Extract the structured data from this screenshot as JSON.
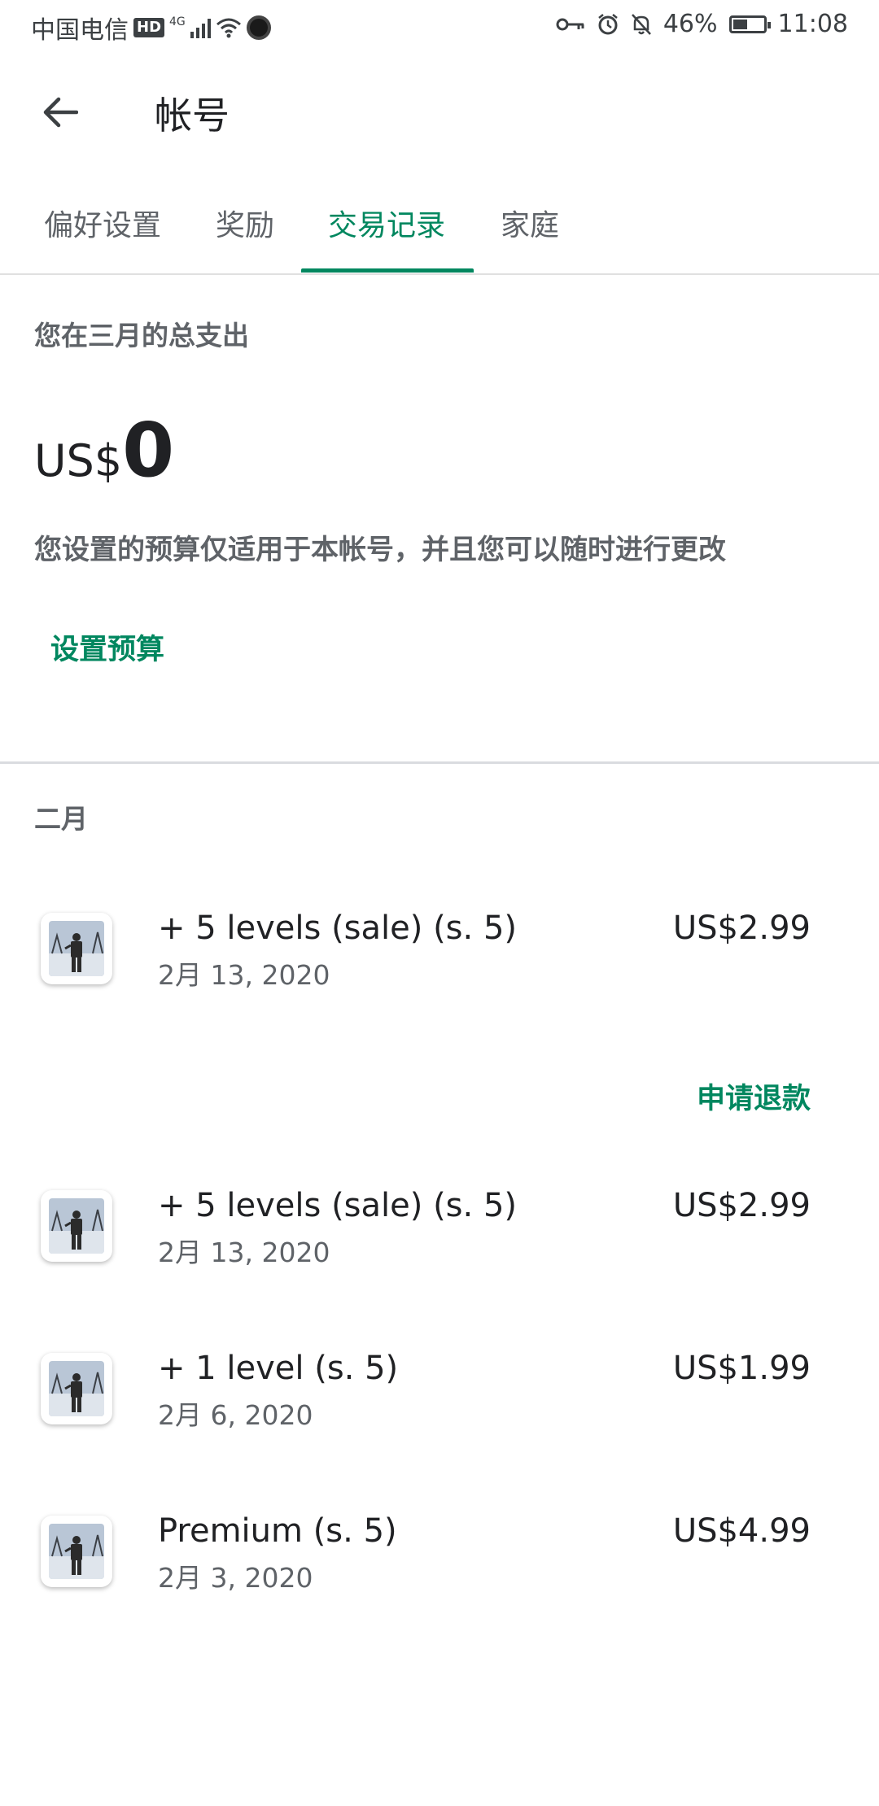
{
  "status_bar": {
    "carrier": "中国电信",
    "hd": "HD",
    "network": "4G",
    "battery": "46%",
    "battery_level": 0.46,
    "time": "11:08"
  },
  "header": {
    "back_icon": "arrow-left-icon",
    "title": "帐号"
  },
  "tabs": [
    {
      "label": "偏好设置",
      "active": false
    },
    {
      "label": "奖励",
      "active": false
    },
    {
      "label": "交易记录",
      "active": true
    },
    {
      "label": "家庭",
      "active": false
    }
  ],
  "spending": {
    "label": "您在三月的总支出",
    "currency": "US$",
    "amount": "0",
    "description": "您设置的预算仅适用于本帐号，并且您可以随时进行更改",
    "set_budget": "设置预算"
  },
  "month_label": "二月",
  "refund_label": "申请退款",
  "transactions": [
    {
      "name": "+ 5 levels (sale) (s. 5)",
      "date": "2月 13, 2020",
      "price": "US$2.99"
    },
    {
      "name": "+ 5 levels (sale) (s. 5)",
      "date": "2月 13, 2020",
      "price": "US$2.99"
    },
    {
      "name": "+ 1 level (s. 5)",
      "date": "2月 6, 2020",
      "price": "US$1.99"
    },
    {
      "name": "Premium (s. 5)",
      "date": "2月 3, 2020",
      "price": "US$4.99"
    }
  ],
  "colors": {
    "accent": "#01875f",
    "text_primary": "#202124",
    "text_secondary": "#5f6368"
  }
}
